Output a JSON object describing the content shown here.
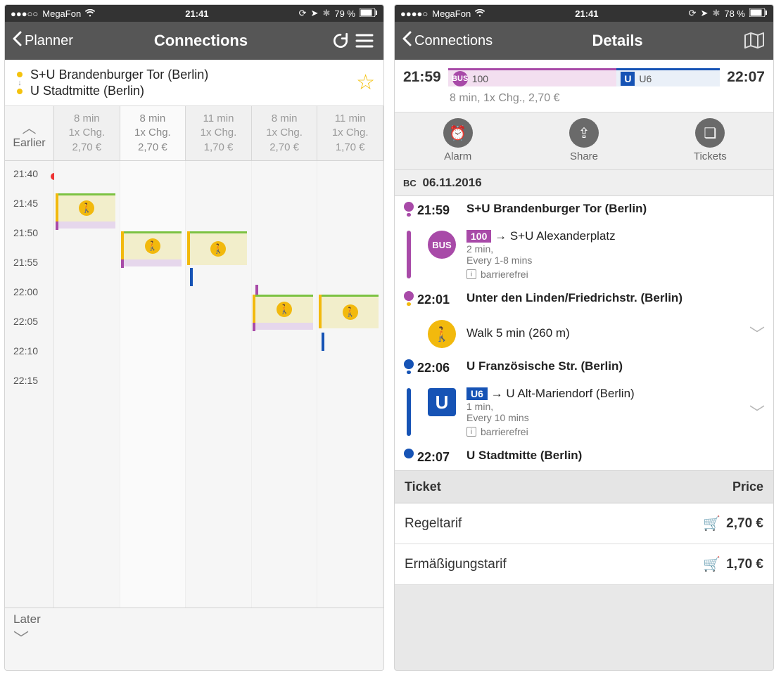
{
  "left": {
    "status": {
      "carrier": "MegaFon",
      "time": "21:41",
      "battery": "79 %"
    },
    "header": {
      "back": "Planner",
      "title": "Connections"
    },
    "route": {
      "from": "S+U Brandenburger Tor (Berlin)",
      "to": "U Stadtmitte (Berlin)"
    },
    "earlier": "Earlier",
    "later": "Later",
    "columns": [
      {
        "dur": "8 min",
        "chg": "1x Chg.",
        "price": "2,70 €"
      },
      {
        "dur": "8 min",
        "chg": "1x Chg.",
        "price": "2,70 €"
      },
      {
        "dur": "11 min",
        "chg": "1x Chg.",
        "price": "1,70 €"
      },
      {
        "dur": "8 min",
        "chg": "1x Chg.",
        "price": "2,70 €"
      },
      {
        "dur": "11 min",
        "chg": "1x Chg.",
        "price": "1,70 €"
      }
    ],
    "times": [
      "21:40",
      "21:45",
      "21:50",
      "21:55",
      "22:00",
      "22:05",
      "22:10",
      "22:15"
    ]
  },
  "right": {
    "status": {
      "carrier": "MegaFon",
      "time": "21:41",
      "battery": "78 %"
    },
    "header": {
      "back": "Connections",
      "title": "Details"
    },
    "summary": {
      "dep": "21:59",
      "arr": "22:07",
      "seg1": "100",
      "seg2": "U6",
      "sub": "8 min, 1x Chg., 2,70 €"
    },
    "actions": {
      "alarm": "Alarm",
      "share": "Share",
      "tickets": "Tickets"
    },
    "date_prefix": "BC",
    "date": "06.11.2016",
    "steps": {
      "a_time": "21:59",
      "a_label": "S+U Brandenburger Tor (Berlin)",
      "bus_badge": "100",
      "bus_dest": "S+U Alexanderplatz",
      "bus_line1": "2 min,",
      "bus_line2": "Every 1-8 mins",
      "bus_acc": "barrierefrei",
      "b_time": "22:01",
      "b_label": "Unter den Linden/Friedrichstr. (Berlin)",
      "walk": "Walk 5 min (260 m)",
      "c_time": "22:06",
      "c_label": "U Französische Str. (Berlin)",
      "u_badge": "U6",
      "u_dest": "U Alt-Mariendorf (Berlin)",
      "u_line1": "1 min,",
      "u_line2": "Every 10 mins",
      "u_acc": "barrierefrei",
      "d_time": "22:07",
      "d_label": "U Stadtmitte (Berlin)"
    },
    "ticket_head": {
      "t": "Ticket",
      "p": "Price"
    },
    "tickets": [
      {
        "name": "Regeltarif",
        "price": "2,70 €"
      },
      {
        "name": "Ermäßigungstarif",
        "price": "1,70 €"
      }
    ]
  }
}
